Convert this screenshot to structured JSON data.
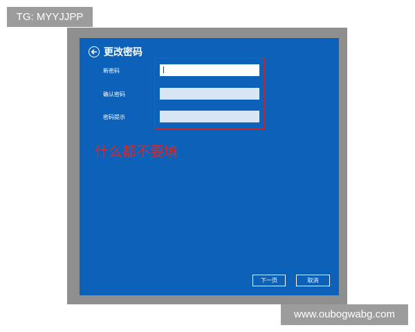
{
  "watermarks": {
    "top": "TG: MYYJJPP",
    "bottom": "www.oubogwabg.com"
  },
  "dialog": {
    "title": "更改密码",
    "back_icon": "back-arrow-circle-icon",
    "fields": [
      {
        "label": "新密码",
        "value": "",
        "placeholder": ""
      },
      {
        "label": "确认密码",
        "value": "",
        "placeholder": ""
      },
      {
        "label": "密码提示",
        "value": "",
        "placeholder": ""
      }
    ],
    "buttons": {
      "next": "下一页",
      "cancel": "取消"
    }
  },
  "annotation": {
    "text": "什么都不要填",
    "color": "#d42a2e"
  },
  "colors": {
    "panel": "#0b62b8",
    "frame": "#8f8f8f",
    "highlight": "#d0262b"
  }
}
